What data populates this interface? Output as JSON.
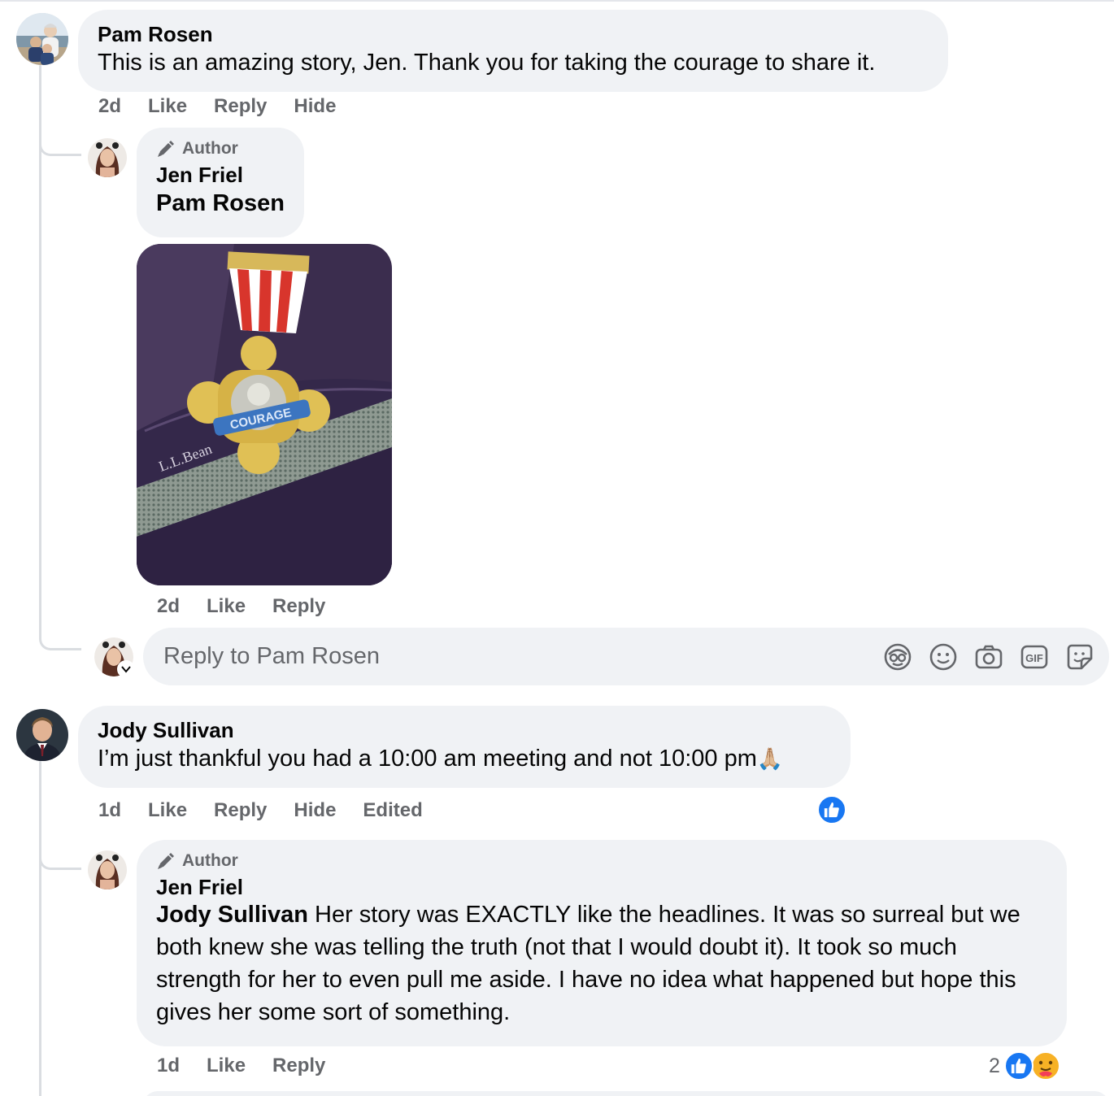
{
  "comments": [
    {
      "author": "Pam Rosen",
      "text": "This is an amazing story, Jen. Thank you for taking the courage to share it.",
      "actions": {
        "time": "2d",
        "like": "Like",
        "reply": "Reply",
        "hide": "Hide"
      },
      "reply": {
        "badge": "Author",
        "author": "Jen Friel",
        "mention": "Pam Rosen",
        "photo_text": [
          "L.L.Bean",
          "COURAGE"
        ],
        "actions": {
          "time": "2d",
          "like": "Like",
          "reply": "Reply"
        }
      },
      "composer": {
        "placeholder": "Reply to Pam Rosen",
        "icons": [
          "avatar-sticker-icon",
          "emoji-icon",
          "camera-icon",
          "gif-icon",
          "sticker-icon"
        ]
      }
    },
    {
      "author": "Jody Sullivan",
      "text": "I’m just thankful you had a 10:00 am meeting and not 10:00 pm",
      "emoji": "🙏🏼",
      "actions": {
        "time": "1d",
        "like": "Like",
        "reply": "Reply",
        "hide": "Hide",
        "edited": "Edited"
      },
      "reactions": [
        "like"
      ],
      "reply": {
        "badge": "Author",
        "author": "Jen Friel",
        "mention": "Jody Sullivan",
        "text": "Her story was EXACTLY like the headlines. It was so surreal but we both knew she was telling the truth (not that I would doubt it). It took so much strength for her to even pull me aside. I have no idea what happened but hope this gives her some sort of something.",
        "actions": {
          "time": "1d",
          "like": "Like",
          "reply": "Reply"
        },
        "reaction_count": "2",
        "reactions": [
          "like",
          "care"
        ]
      }
    }
  ],
  "colors": {
    "bubble": "#f0f2f5",
    "meta": "#65676b",
    "like_blue": "#1877f2",
    "thread_line": "#dadde1"
  }
}
